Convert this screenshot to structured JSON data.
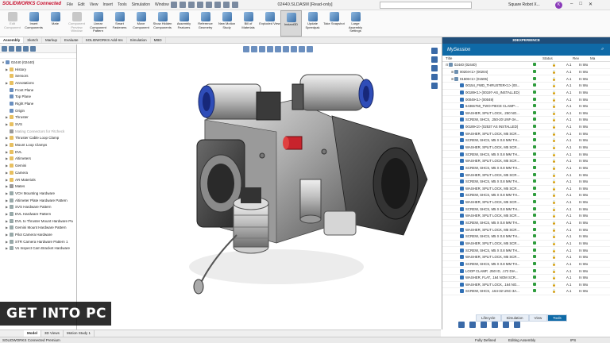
{
  "app": {
    "logo": "SOLIDWORKS Connected",
    "document_title": "02440.SLDASM [Read-only]",
    "search_placeholder": "",
    "user_name": "Square Robot X...",
    "user_initial": "K",
    "window_buttons": [
      "–",
      "□",
      "✕"
    ]
  },
  "menu": [
    "File",
    "Edit",
    "View",
    "Insert",
    "Tools",
    "Simulation",
    "Window"
  ],
  "ribbon": [
    {
      "label": "Edit Component",
      "disabled": true
    },
    {
      "label": "Insert Components",
      "disabled": false
    },
    {
      "label": "Mate",
      "disabled": false
    },
    {
      "label": "Component Preview Window",
      "disabled": true
    },
    {
      "label": "Linear Component Pattern",
      "disabled": false
    },
    {
      "label": "Smart Fasteners",
      "disabled": false
    },
    {
      "label": "Move Component",
      "disabled": false
    },
    {
      "label": "Show Hidden Components",
      "disabled": false
    },
    {
      "label": "Assembly Features",
      "disabled": false
    },
    {
      "label": "Reference Geometry",
      "disabled": false
    },
    {
      "label": "New Motion Study",
      "disabled": false
    },
    {
      "label": "Bill of Materials",
      "disabled": false
    },
    {
      "label": "Exploded View",
      "disabled": false
    },
    {
      "label": "Instant3D",
      "disabled": false,
      "active": true
    },
    {
      "label": "Update Speedpak",
      "disabled": false
    },
    {
      "label": "Take Snapshot",
      "disabled": false
    },
    {
      "label": "Large Assembly Settings",
      "disabled": false
    }
  ],
  "command_tabs": [
    "Assembly",
    "Sketch",
    "Markup",
    "Evaluate",
    "SOLIDWORKS Add-Ins",
    "Simulation",
    "MBD"
  ],
  "command_tabs_selected": "Assembly",
  "tree": {
    "root": "02440 (02440)",
    "items": [
      {
        "label": "History",
        "icon": "folder",
        "tw": "▶"
      },
      {
        "label": "Sensors",
        "icon": "folder",
        "tw": ""
      },
      {
        "label": "Annotations",
        "icon": "folder",
        "tw": "▶"
      },
      {
        "label": "Front Plane",
        "icon": "plane",
        "tw": ""
      },
      {
        "label": "Top Plane",
        "icon": "plane",
        "tw": ""
      },
      {
        "label": "Right Plane",
        "icon": "plane",
        "tw": ""
      },
      {
        "label": "Origin",
        "icon": "plane",
        "tw": ""
      },
      {
        "label": "Thruster",
        "icon": "folder",
        "tw": "▶"
      },
      {
        "label": "SVS",
        "icon": "folder",
        "tw": "▶"
      },
      {
        "label": "Mating Connectors for Fitcheck",
        "icon": "mate",
        "tw": "",
        "gray": true
      },
      {
        "label": "Thruster Cable Loop Clamp",
        "icon": "folder",
        "tw": "▶"
      },
      {
        "label": "Mount Loop Clamps",
        "icon": "folder",
        "tw": "▶"
      },
      {
        "label": "DVL",
        "icon": "folder",
        "tw": "▶"
      },
      {
        "label": "Altimeters",
        "icon": "folder",
        "tw": "▶"
      },
      {
        "label": "Gemini",
        "icon": "folder",
        "tw": "▶"
      },
      {
        "label": "Camera",
        "icon": "folder",
        "tw": "▶"
      },
      {
        "label": "AR Materials",
        "icon": "folder",
        "tw": "▶"
      },
      {
        "label": "Mates",
        "icon": "mate",
        "tw": "▶"
      },
      {
        "label": "VCH Mounting Hardware",
        "icon": "part",
        "tw": "▶"
      },
      {
        "label": "Altimeter Plate Hardware Pattern",
        "icon": "part",
        "tw": "▶"
      },
      {
        "label": "SVS Hardware Pattern",
        "icon": "part",
        "tw": "▶"
      },
      {
        "label": "DVL Hardware Pattern",
        "icon": "part",
        "tw": "▶"
      },
      {
        "label": "DVL to Thruster Mount Hardware Pa",
        "icon": "part",
        "tw": "▶"
      },
      {
        "label": "Gemini Mount Hardware Pattern",
        "icon": "part",
        "tw": "▶"
      },
      {
        "label": "Pilot Camera Hardware",
        "icon": "part",
        "tw": "▶"
      },
      {
        "label": "STR Camera Hardware Pattern 1",
        "icon": "part",
        "tw": "▶"
      },
      {
        "label": "Vs Inspect Cam Bracket Hardware",
        "icon": "part",
        "tw": "▶"
      }
    ]
  },
  "panel": {
    "header": "3DEXPERIENCE",
    "session": "MySession",
    "columns": [
      "Title",
      "Status",
      "Rev",
      "Ma"
    ],
    "rows": [
      {
        "title": "02440 (02440)",
        "exp": "⊟",
        "asm": true,
        "indent": 0,
        "rev": "A.1",
        "ma": "In Wo"
      },
      {
        "title": "00204<1> (00204)",
        "exp": "⊞",
        "asm": true,
        "indent": 1,
        "rev": "A.1",
        "ma": "In Wo"
      },
      {
        "title": "01506<1> (01506)",
        "exp": "⊞",
        "asm": true,
        "indent": 1,
        "rev": "A.1",
        "ma": "In Wo"
      },
      {
        "title": "00154_FWD_THRUSTER<1> (00...",
        "indent": 2,
        "rev": "A.1",
        "ma": "In Wo"
      },
      {
        "title": "00189<1> (00197-AS_INSTALLED)",
        "indent": 2,
        "rev": "A.1",
        "ma": "In Wo"
      },
      {
        "title": "00049<1> (00049)",
        "indent": 2,
        "rev": "A.1",
        "ma": "In Wo"
      },
      {
        "title": "64366750_TWO-PIECE CLAMP-...",
        "indent": 2,
        "rev": "A.1",
        "ma": "In Wo"
      },
      {
        "title": "WASHER, SPLIT LOCK, .250 NO...",
        "indent": 2,
        "rev": "A.1",
        "ma": "In Wo"
      },
      {
        "title": "SCREW, SHCS, .250-20 UNF-3A...",
        "indent": 2,
        "rev": "A.1",
        "ma": "In Wo"
      },
      {
        "title": "00189<2> (02537 AS INSTALLED)",
        "indent": 2,
        "rev": "A.1",
        "ma": "In Wo"
      },
      {
        "title": "WASHER, SPLIT LOCK, M5 SCR...",
        "indent": 2,
        "rev": "A.1",
        "ma": "In Wo"
      },
      {
        "title": "SCREW, SHCS, M5 X 0.8 MM TH...",
        "indent": 2,
        "rev": "A.1",
        "ma": "In Wo"
      },
      {
        "title": "WASHER, SPLIT LOCK, M5 SCR...",
        "indent": 2,
        "rev": "A.1",
        "ma": "In Wo"
      },
      {
        "title": "SCREW, SHCS, M5 X 0.8 MM TH...",
        "indent": 2,
        "rev": "A.1",
        "ma": "In Wo"
      },
      {
        "title": "WASHER, SPLIT LOCK, M5 SCR...",
        "indent": 2,
        "rev": "A.1",
        "ma": "In Wo"
      },
      {
        "title": "SCREW, SHCS, M5 X 0.8 MM TH...",
        "indent": 2,
        "rev": "A.1",
        "ma": "In Wo"
      },
      {
        "title": "WASHER, SPLIT LOCK, M5 SCR...",
        "indent": 2,
        "rev": "A.1",
        "ma": "In Wo"
      },
      {
        "title": "SCREW, SHCS, M5 X 0.8 MM TH...",
        "indent": 2,
        "rev": "A.1",
        "ma": "In Wo"
      },
      {
        "title": "WASHER, SPLIT LOCK, M5 SCR...",
        "indent": 2,
        "rev": "A.1",
        "ma": "In Wo"
      },
      {
        "title": "SCREW, SHCS, M5 X 0.8 MM TH...",
        "indent": 2,
        "rev": "A.1",
        "ma": "In Wo"
      },
      {
        "title": "WASHER, SPLIT LOCK, M5 SCR...",
        "indent": 2,
        "rev": "A.1",
        "ma": "In Wo"
      },
      {
        "title": "SCREW, SHCS, M5 X 0.8 MM TH...",
        "indent": 2,
        "rev": "A.1",
        "ma": "In Wo"
      },
      {
        "title": "WASHER, SPLIT LOCK, M5 SCR...",
        "indent": 2,
        "rev": "A.1",
        "ma": "In Wo"
      },
      {
        "title": "SCREW, SHCS, M5 X 0.8 MM TH...",
        "indent": 2,
        "rev": "A.1",
        "ma": "In Wo"
      },
      {
        "title": "WASHER, SPLIT LOCK, M5 SCR...",
        "indent": 2,
        "rev": "A.1",
        "ma": "In Wo"
      },
      {
        "title": "SCREW, SHCS, M5 X 0.8 MM TH...",
        "indent": 2,
        "rev": "A.1",
        "ma": "In Wo"
      },
      {
        "title": "WASHER, SPLIT LOCK, M5 SCR...",
        "indent": 2,
        "rev": "A.1",
        "ma": "In Wo"
      },
      {
        "title": "SCREW, SHCS, M5 X 0.8 MM TH...",
        "indent": 2,
        "rev": "A.1",
        "ma": "In Wo"
      },
      {
        "title": "WASHER, SPLIT LOCK, M5 SCR...",
        "indent": 2,
        "rev": "A.1",
        "ma": "In Wo"
      },
      {
        "title": "SCREW, SHCS, M5 X 0.8 MM TH...",
        "indent": 2,
        "rev": "A.1",
        "ma": "In Wo"
      },
      {
        "title": "LOOP CLAMP, .250 ID, .172 DIA...",
        "indent": 2,
        "rev": "A.1",
        "ma": "In Wo"
      },
      {
        "title": "WASHER, FLAT, .164 NOM SCR...",
        "indent": 2,
        "rev": "A.1",
        "ma": "In Wo"
      },
      {
        "title": "WASHER, SPLIT LOCK, .164 NO...",
        "indent": 2,
        "rev": "A.1",
        "ma": "In Wo"
      },
      {
        "title": "SCREW, SHCS, .164-32 UNC-3A...",
        "indent": 2,
        "rev": "A.1",
        "ma": "In Wo"
      }
    ],
    "tabs": [
      "Lifecycle",
      "Simulation",
      "View",
      "Tools"
    ],
    "tab_selected": "Tools"
  },
  "bottom_tabs": [
    "Model",
    "3D Views",
    "Motion Study 1"
  ],
  "bottom_tab_selected": "Model",
  "status": {
    "left": "SOLIDWORKS Connected Premium",
    "defined": "Fully Defined",
    "editing": "Editing Assembly",
    "units": "IPS"
  },
  "watermark": "GET INTO PC"
}
